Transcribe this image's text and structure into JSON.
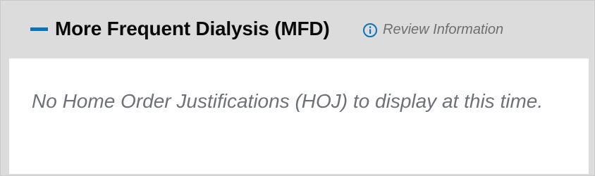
{
  "panel": {
    "title": "More Frequent Dialysis (MFD)",
    "review_link_label": "Review Information",
    "empty_message": "No Home Order Justifications (HOJ) to display at this time.",
    "icons": {
      "toggle": "minus-icon",
      "review": "info-circle-icon"
    },
    "colors": {
      "accent": "#0b73b8",
      "header_bg": "#dcdcdc",
      "muted_text": "#6e7178"
    }
  }
}
